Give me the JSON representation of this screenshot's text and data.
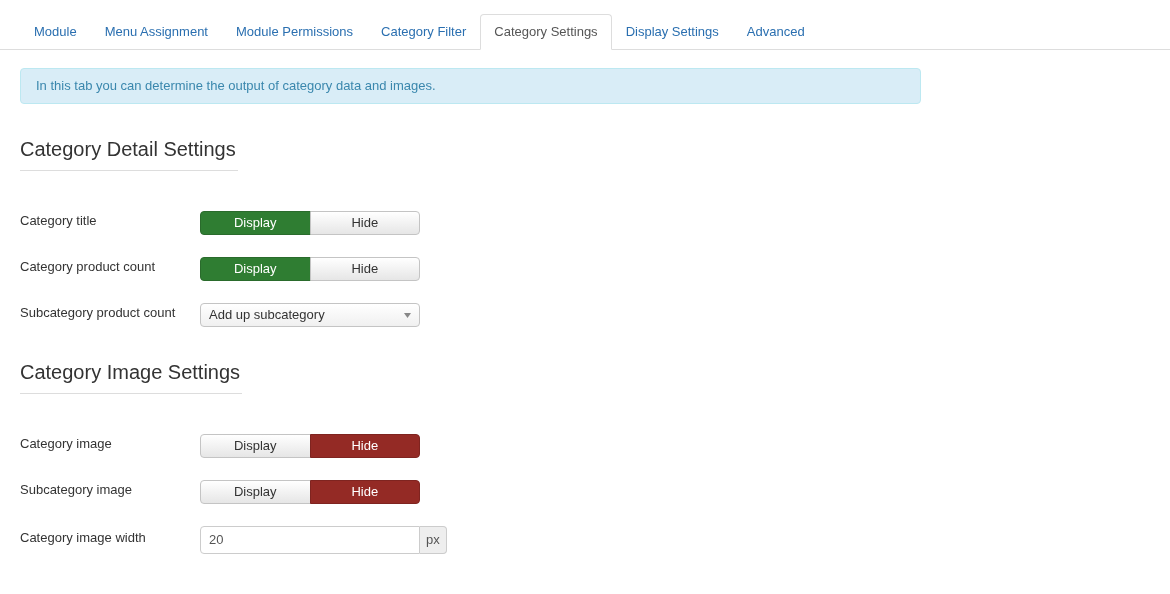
{
  "tabs": [
    {
      "label": "Module",
      "selected": false
    },
    {
      "label": "Menu Assignment",
      "selected": false
    },
    {
      "label": "Module Permissions",
      "selected": false
    },
    {
      "label": "Category Filter",
      "selected": false
    },
    {
      "label": "Category Settings",
      "selected": true
    },
    {
      "label": "Display Settings",
      "selected": false
    },
    {
      "label": "Advanced",
      "selected": false
    }
  ],
  "info": "In this tab you can determine the output of category data and images.",
  "sections": [
    {
      "title": "Category Detail Settings",
      "fields": [
        {
          "kind": "toggle",
          "label": "Category title",
          "options": [
            {
              "label": "Display",
              "kind": "show",
              "selected": true
            },
            {
              "label": "Hide",
              "kind": "hide",
              "selected": false
            }
          ]
        },
        {
          "kind": "toggle",
          "label": "Category product count",
          "options": [
            {
              "label": "Display",
              "kind": "show",
              "selected": true
            },
            {
              "label": "Hide",
              "kind": "hide",
              "selected": false
            }
          ]
        },
        {
          "kind": "select",
          "label": "Subcategory product count",
          "value": "Add up subcategory"
        }
      ]
    },
    {
      "title": "Category Image Settings",
      "fields": [
        {
          "kind": "toggle",
          "label": "Category image",
          "options": [
            {
              "label": "Display",
              "kind": "show",
              "selected": false
            },
            {
              "label": "Hide",
              "kind": "hide",
              "selected": true
            }
          ]
        },
        {
          "kind": "toggle",
          "label": "Subcategory image",
          "options": [
            {
              "label": "Display",
              "kind": "show",
              "selected": false
            },
            {
              "label": "Hide",
              "kind": "hide",
              "selected": true
            }
          ]
        },
        {
          "kind": "number",
          "label": "Category image width",
          "value": "20",
          "unit": "px"
        }
      ]
    }
  ]
}
